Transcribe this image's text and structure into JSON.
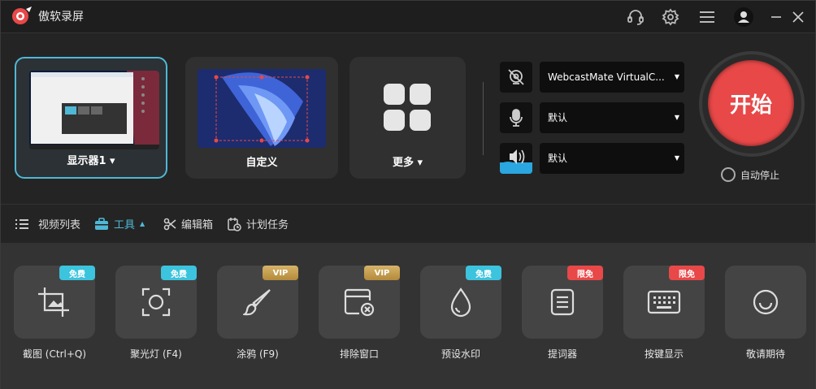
{
  "app": {
    "title": "傲软录屏"
  },
  "modes": [
    {
      "label": "显示器1 ▾"
    },
    {
      "label": "自定义"
    },
    {
      "label": "更多 ▾"
    }
  ],
  "sources": {
    "camera": {
      "value": "WebcastMate VirtualC...",
      "caret": "▼"
    },
    "microphone": {
      "value": "默认",
      "caret": "▼"
    },
    "speaker": {
      "value": "默认",
      "caret": "▼"
    }
  },
  "start_button": {
    "label": "开始"
  },
  "auto_stop": {
    "label": "自动停止"
  },
  "tabs": [
    {
      "label": "视频列表"
    },
    {
      "label": "工具",
      "active": true
    },
    {
      "label": "编辑箱"
    },
    {
      "label": "计划任务"
    }
  ],
  "tools": [
    {
      "label": "截图 (Ctrl+Q)",
      "badge": "免费",
      "badge_color": "#3cc3dd",
      "icon": "screenshot-icon"
    },
    {
      "label": "聚光灯 (F4)",
      "badge": "免费",
      "badge_color": "#3cc3dd",
      "icon": "spotlight-icon"
    },
    {
      "label": "涂鸦 (F9)",
      "badge": "VIP",
      "badge_color": "#c9a050",
      "icon": "brush-icon"
    },
    {
      "label": "排除窗口",
      "badge": "VIP",
      "badge_color": "#c9a050",
      "icon": "exclude-window-icon"
    },
    {
      "label": "预设水印",
      "badge": "免费",
      "badge_color": "#3cc3dd",
      "icon": "watermark-icon"
    },
    {
      "label": "提词器",
      "badge": "限免",
      "badge_color": "#e84848",
      "icon": "teleprompter-icon"
    },
    {
      "label": "按键显示",
      "badge": "限免",
      "badge_color": "#e84848",
      "icon": "keyboard-icon"
    },
    {
      "label": "敬请期待",
      "badge": "",
      "badge_color": "",
      "icon": "coming-soon-icon"
    }
  ],
  "colors": {
    "accent": "#4fb8d6",
    "start": "#e84848"
  }
}
